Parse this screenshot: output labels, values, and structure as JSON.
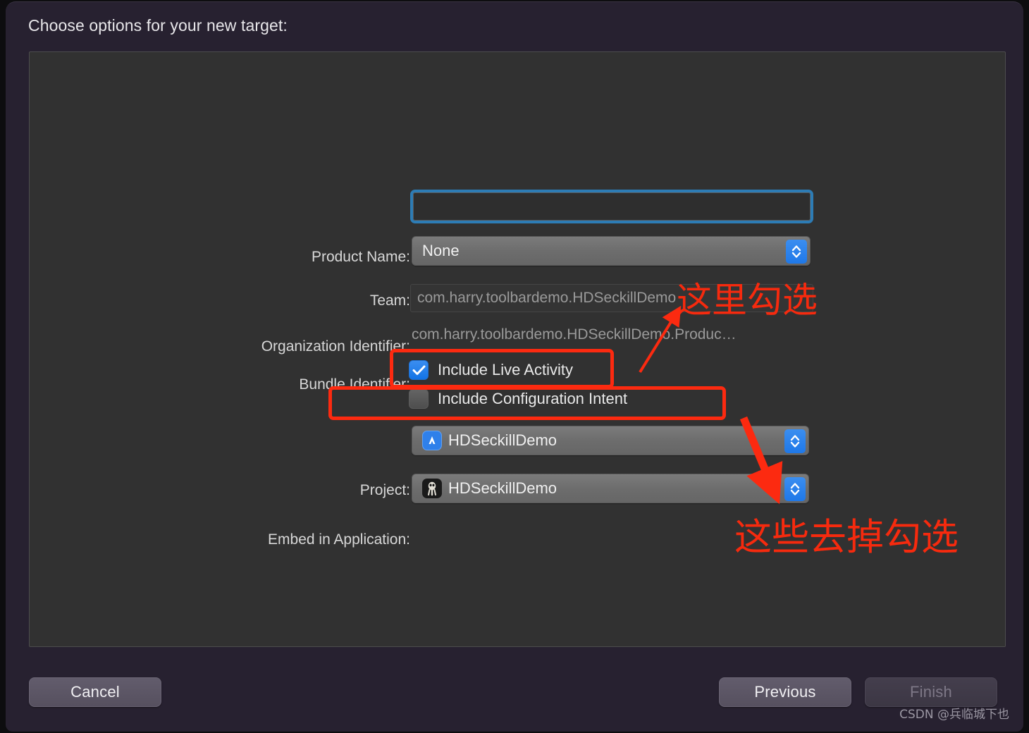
{
  "dialog": {
    "title": "Choose options for your new target:"
  },
  "form": {
    "product_name": {
      "label": "Product Name:",
      "value": "",
      "placeholder": ""
    },
    "team": {
      "label": "Team:",
      "value": "None"
    },
    "organization_identifier": {
      "label": "Organization Identifier:",
      "value": "",
      "placeholder": "com.harry.toolbardemo.HDSeckillDemo"
    },
    "bundle_identifier": {
      "label": "Bundle Identifier:",
      "value": "com.harry.toolbardemo.HDSeckillDemo.Produc…"
    },
    "include_live_activity": {
      "label": "Include Live Activity",
      "checked": true
    },
    "include_configuration_intent": {
      "label": "Include Configuration Intent",
      "checked": false
    },
    "project": {
      "label": "Project:",
      "value": "HDSeckillDemo",
      "icon": "xcode-project-icon"
    },
    "embed_in_application": {
      "label": "Embed in Application:",
      "value": "HDSeckillDemo",
      "icon": "app-bundle-icon"
    }
  },
  "annotations": {
    "color": "#fc2a10",
    "check_here": "这里勾选",
    "uncheck_these": "这些去掉勾选"
  },
  "footer": {
    "cancel": "Cancel",
    "previous": "Previous",
    "finish": "Finish"
  },
  "watermark": {
    "text": "CSDN @兵临城下也"
  }
}
